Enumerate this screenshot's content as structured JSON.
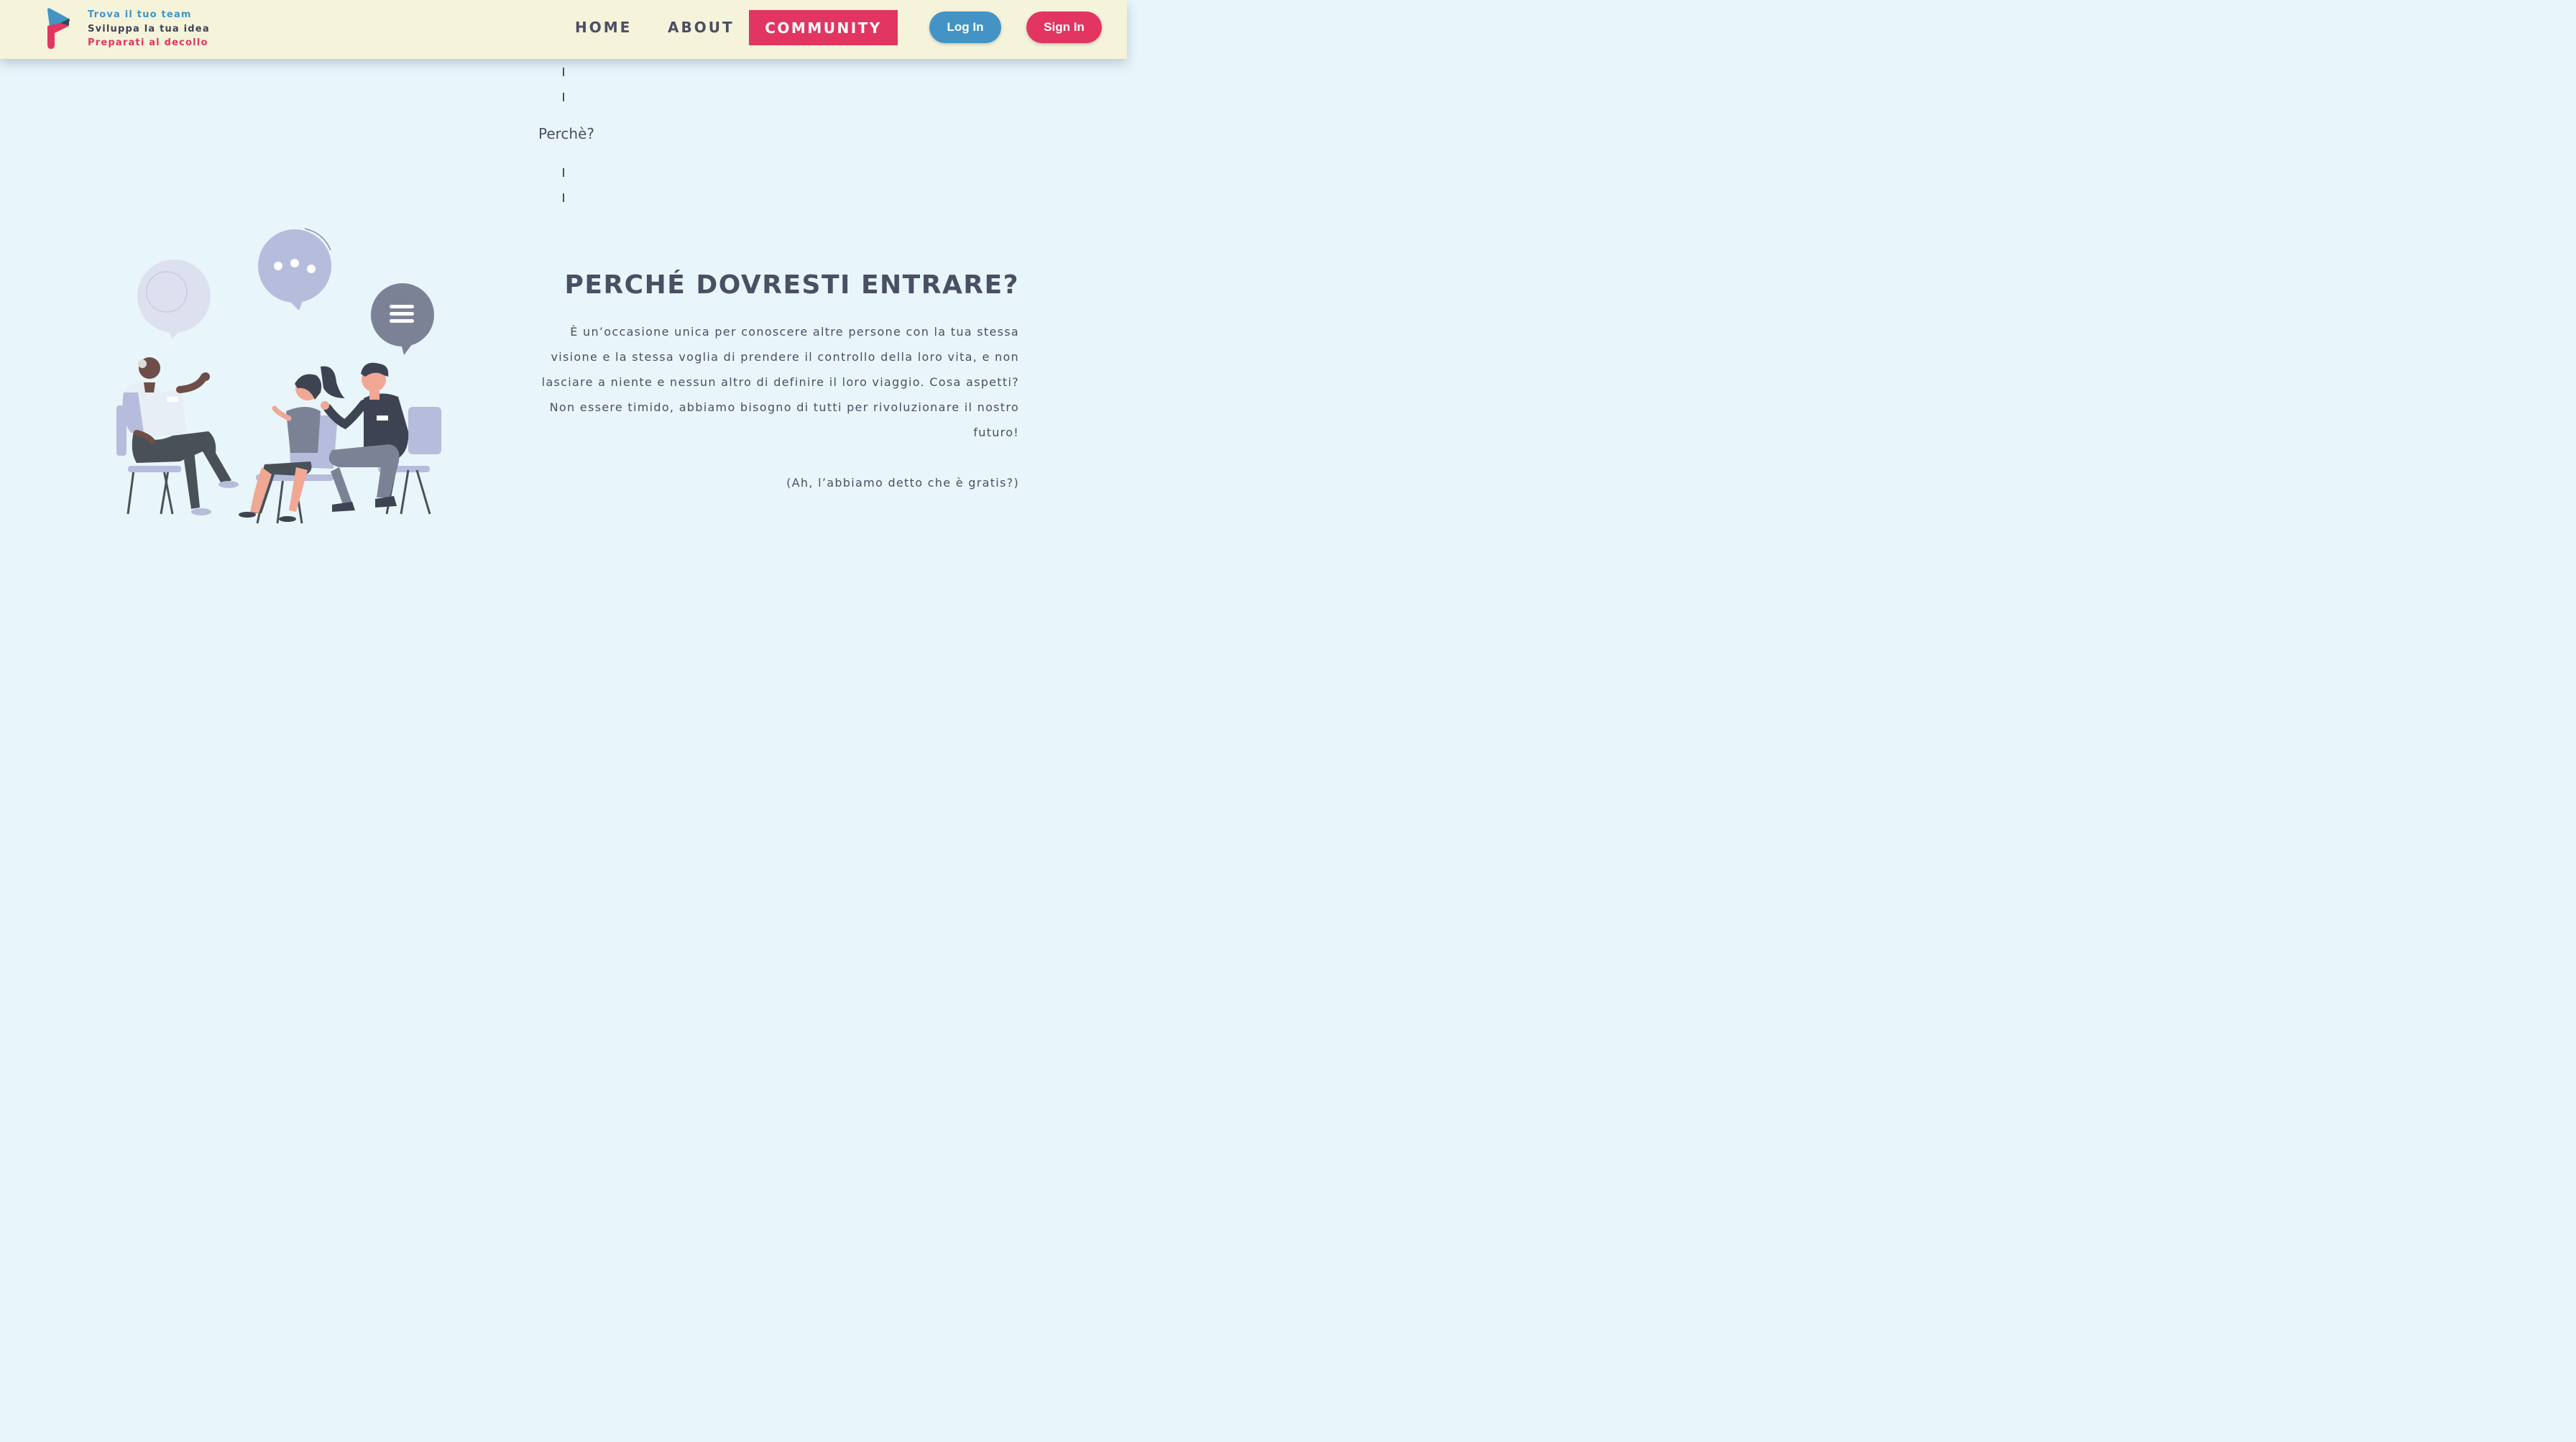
{
  "brand": {
    "tagline": [
      {
        "text": "Trova il tuo team",
        "color": "#4394c5"
      },
      {
        "text": "Sviluppa la tua idea",
        "color": "#3e4352"
      },
      {
        "text": "Preparati al decollo",
        "color": "#e23561"
      }
    ],
    "logo_icon": "rocket-p-logo-icon"
  },
  "nav": {
    "home": "HOME",
    "about": "ABOUT",
    "community": "COMMUNITY",
    "login": "Log In",
    "signin": "Sign In"
  },
  "section": {
    "why_label": "Perchè?",
    "heading": "PERCHÉ DOVRESTI ENTRARE?",
    "body": "È un’occasione unica per conoscere altre persone con la tua stessa visione e la stessa voglia di prendere il controllo della loro vita, e non lasciare a niente e nessun altro di definire il loro viaggio. Cosa aspetti? Non essere timido, abbiamo bisogno di tutti per rivoluzionare il nostro futuro!",
    "aside": "(Ah, l’abbiamo detto che è gratis?)"
  },
  "illustration": "people-chatting-illustration",
  "colors": {
    "accent_red": "#e23561",
    "accent_blue": "#4394c5",
    "nav_bg": "#f5f3da",
    "page_bg": "#e8f5fb",
    "text": "#4a4f63"
  }
}
